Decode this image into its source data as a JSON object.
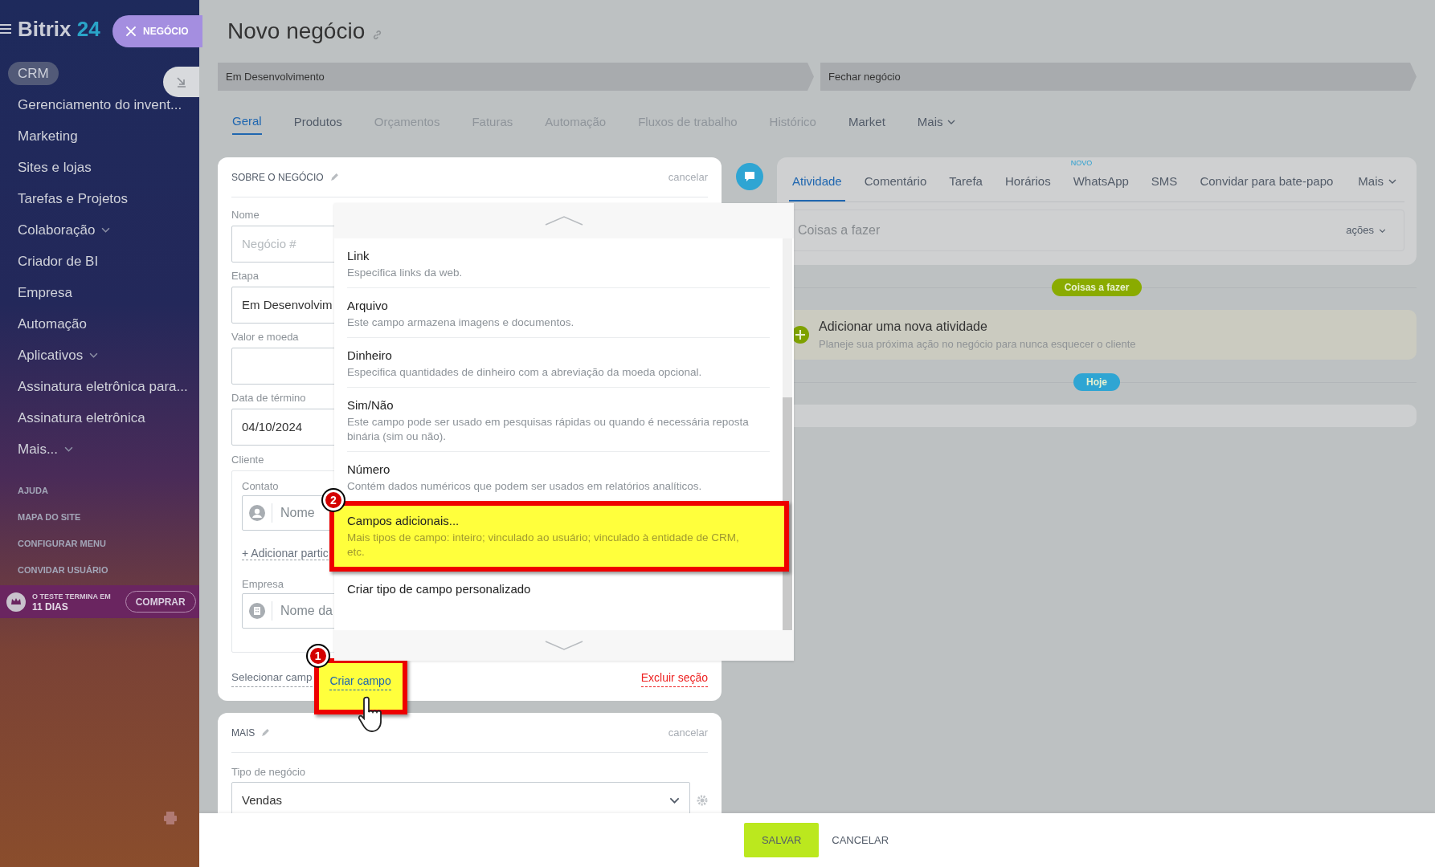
{
  "sidebar": {
    "logo": {
      "text": "Bitrix",
      "number": "24"
    },
    "close_chip": "NEGÓCIO",
    "items": [
      {
        "label": "CRM",
        "selected": true,
        "has_submenu": false
      },
      {
        "label": "Gerenciamento do invent...",
        "selected": false,
        "has_submenu": false
      },
      {
        "label": "Marketing",
        "selected": false,
        "has_submenu": false
      },
      {
        "label": "Sites e lojas",
        "selected": false,
        "has_submenu": false
      },
      {
        "label": "Tarefas e Projetos",
        "selected": false,
        "has_submenu": false
      },
      {
        "label": "Colaboração",
        "selected": false,
        "has_submenu": true
      },
      {
        "label": "Criador de BI",
        "selected": false,
        "has_submenu": false
      },
      {
        "label": "Empresa",
        "selected": false,
        "has_submenu": false
      },
      {
        "label": "Automação",
        "selected": false,
        "has_submenu": false
      },
      {
        "label": "Aplicativos",
        "selected": false,
        "has_submenu": true
      },
      {
        "label": "Assinatura eletrônica para...",
        "selected": false,
        "has_submenu": false
      },
      {
        "label": "Assinatura eletrônica",
        "selected": false,
        "has_submenu": false
      },
      {
        "label": "Mais...",
        "selected": false,
        "has_submenu": true
      }
    ],
    "footer_links": [
      "AJUDA",
      "MAPA DO SITE",
      "CONFIGURAR MENU",
      "CONVIDAR USUÁRIO"
    ],
    "trial": {
      "line1": "O TESTE TERMINA EM",
      "line2": "11 DIAS",
      "button": "COMPRAR"
    }
  },
  "page": {
    "title": "Novo negócio"
  },
  "stages": [
    "Em Desenvolvimento",
    "Fechar negócio"
  ],
  "tabs": [
    {
      "label": "Geral",
      "selected": true,
      "disabled": false
    },
    {
      "label": "Produtos",
      "selected": false,
      "disabled": false
    },
    {
      "label": "Orçamentos",
      "selected": false,
      "disabled": true
    },
    {
      "label": "Faturas",
      "selected": false,
      "disabled": true
    },
    {
      "label": "Automação",
      "selected": false,
      "disabled": true
    },
    {
      "label": "Fluxos de trabalho",
      "selected": false,
      "disabled": true
    },
    {
      "label": "Histórico",
      "selected": false,
      "disabled": true
    },
    {
      "label": "Market",
      "selected": false,
      "disabled": false
    },
    {
      "label": "Mais",
      "selected": false,
      "disabled": false,
      "dropdown": true
    }
  ],
  "about_card": {
    "title": "SOBRE O NEGÓCIO",
    "cancel": "cancelar",
    "fields": [
      {
        "label": "Nome",
        "placeholder": "Negócio #"
      },
      {
        "label": "Etapa",
        "value": "Em Desenvolvim"
      },
      {
        "label": "Valor e moeda"
      },
      {
        "label": "Data de término",
        "value": "04/10/2024"
      }
    ],
    "client": {
      "label": "Cliente",
      "contact": {
        "label": "Contato",
        "placeholder": "Nome"
      },
      "add_link": "+ Adicionar partic",
      "company": {
        "label": "Empresa",
        "placeholder": "Nome da"
      }
    },
    "footer": {
      "select": "Selecionar camp",
      "create": "Criar campo",
      "delete": "Excluir seção"
    }
  },
  "field_type_menu": {
    "items": [
      {
        "title": "Link",
        "description": "Especifica links da web.",
        "selected": false
      },
      {
        "title": "Arquivo",
        "description": "Este campo armazena imagens e documentos.",
        "selected": false
      },
      {
        "title": "Dinheiro",
        "description": "Especifica quantidades de dinheiro com a abreviação da moeda opcional.",
        "selected": false
      },
      {
        "title": "Sim/Não",
        "description": "Este campo pode ser usado em pesquisas rápidas ou quando é necessária reposta binária (sim ou não).",
        "selected": false
      },
      {
        "title": "Número",
        "description": "Contém dados numéricos que podem ser usados em relatórios analíticos.",
        "selected": false
      },
      {
        "title": "Campos adicionais...",
        "description": "Mais tipos de campo: inteiro; vinculado ao usuário; vinculado à entidade de CRM, etc.",
        "selected": true
      },
      {
        "title": "Criar tipo de campo personalizado",
        "selected": false
      }
    ]
  },
  "annotations": [
    {
      "label": "1"
    },
    {
      "label": "2"
    }
  ],
  "more_card": {
    "title": "MAIS",
    "cancel": "cancelar",
    "field": {
      "label": "Tipo de negócio",
      "value": "Vendas"
    }
  },
  "activity": {
    "tabs": [
      {
        "label": "Atividade",
        "selected": true
      },
      {
        "label": "Comentário",
        "selected": false
      },
      {
        "label": "Tarefa",
        "selected": false
      },
      {
        "label": "Horários",
        "selected": false
      },
      {
        "label": "WhatsApp",
        "selected": false,
        "badge": "NOVO"
      },
      {
        "label": "SMS",
        "selected": false
      },
      {
        "label": "Convidar para bate-papo",
        "selected": false
      }
    ],
    "more": "Mais",
    "input": {
      "placeholder": "Coisas a fazer"
    },
    "actions": "ações",
    "timeline": [
      {
        "kind": "pill",
        "label": "Coisas a fazer",
        "color": "#8aab00"
      },
      {
        "kind": "card",
        "title": "Adicionar uma nova atividade",
        "subtitle": "Planeje sua próxima ação no negócio para nunca esquecer o cliente"
      },
      {
        "kind": "pill",
        "label": "Hoje",
        "color": "#2fa5d3"
      },
      {
        "kind": "empty"
      }
    ]
  },
  "footer_buttons": [
    "SALVAR",
    "CANCELAR"
  ]
}
